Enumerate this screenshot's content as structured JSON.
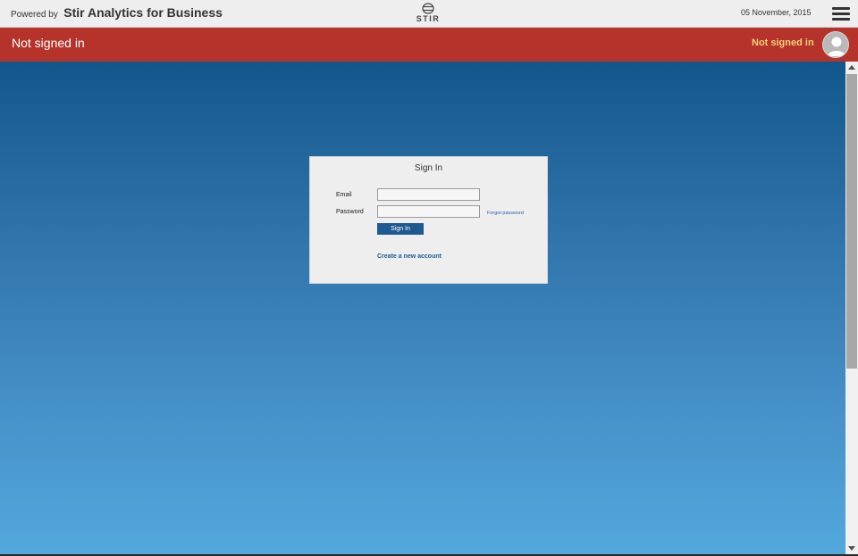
{
  "header": {
    "powered_by": "Powered by",
    "brand": "Stir Analytics for Business",
    "logo_text": "STIR",
    "logo_icon": "stir-globe-icon",
    "date": "05 November, 2015",
    "menu_icon": "hamburger-menu-icon"
  },
  "status": {
    "left_text": "Not signed in",
    "right_text": "Not signed in",
    "avatar_icon": "user-avatar-icon",
    "bar_color": "#b5332b",
    "right_text_color": "#f2d27a"
  },
  "signin": {
    "title": "Sign In",
    "email_label": "Email",
    "email_value": "",
    "password_label": "Password",
    "password_value": "",
    "forgot_label": "Forgot password",
    "button_label": "Sign In",
    "create_account_label": "Create a new account"
  },
  "colors": {
    "accent": "#1d5a92",
    "gradient_top": "#11578c",
    "gradient_bottom": "#52a8dc"
  }
}
